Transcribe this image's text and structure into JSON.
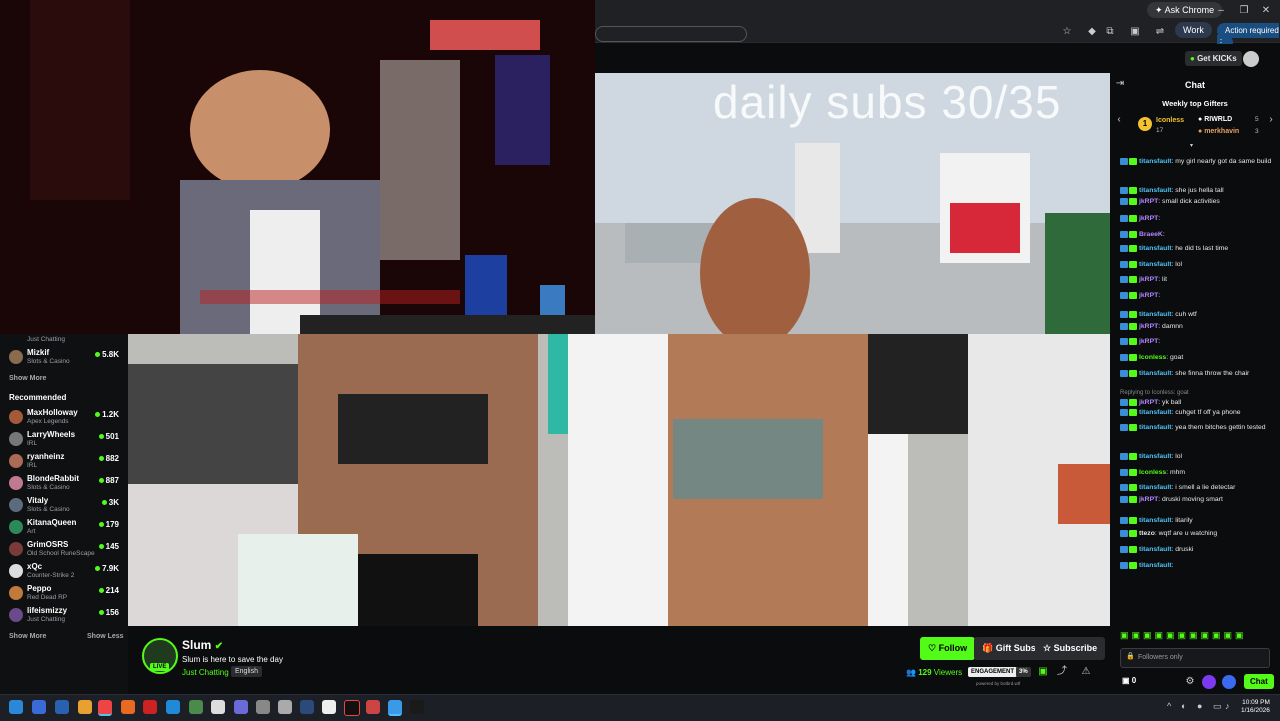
{
  "browser": {
    "ask_label": "Ask Chrome",
    "work_label": "Work",
    "action_label": "Action required"
  },
  "header": {
    "get_kicks": "Get KICKs"
  },
  "overlay_text": "daily subs 30/35",
  "sidebar": {
    "top_items": [
      {
        "name": "",
        "category": "Just Chatting",
        "count": "",
        "color": "#c98a5a"
      },
      {
        "name": "Mizkif",
        "category": "Slots & Casino",
        "count": "5.8K",
        "color": "#8b6b4e"
      }
    ],
    "show_more_1": "Show More",
    "recommended_title": "Recommended",
    "recommended": [
      {
        "name": "MaxHolloway",
        "category": "Apex Legends",
        "count": "1.2K",
        "color": "#a35a3a"
      },
      {
        "name": "LarryWheels",
        "category": "IRL",
        "count": "501",
        "color": "#777"
      },
      {
        "name": "ryanheinz",
        "category": "IRL",
        "count": "882",
        "color": "#aa6a55"
      },
      {
        "name": "BlondeRabbit",
        "category": "Slots & Casino",
        "count": "887",
        "color": "#c07a90"
      },
      {
        "name": "Vitaly",
        "category": "Slots & Casino",
        "count": "3K",
        "color": "#5c6c7c"
      },
      {
        "name": "KitanaQueen",
        "category": "Art",
        "count": "179",
        "color": "#2c8a5a"
      },
      {
        "name": "GrimOSRS",
        "category": "Old School RuneScape",
        "count": "145",
        "color": "#7a3a3a"
      },
      {
        "name": "xQc",
        "category": "Counter-Strike 2",
        "count": "7.9K",
        "color": "#ddd"
      },
      {
        "name": "Peppo",
        "category": "Red Dead RP",
        "count": "214",
        "color": "#c07a3a"
      },
      {
        "name": "lifeismizzy",
        "category": "Just Chatting",
        "count": "156",
        "color": "#6a4a8a"
      }
    ],
    "show_more_2": "Show More",
    "show_less": "Show Less"
  },
  "stream": {
    "channel": "Slum",
    "title": "Slum is here to save the day",
    "category": "Just Chatting",
    "language": "English",
    "live_badge": "LIVE",
    "viewers": "129",
    "viewers_label": "Viewers",
    "engagement_label": "ENGAGEMENT",
    "engagement_value": "3%",
    "powered_by": "powered by botbrd.wtf",
    "follow": "Follow",
    "gift_subs": "Gift Subs",
    "subscribe": "Subscribe"
  },
  "chat": {
    "title": "Chat",
    "gifters_title": "Weekly top Gifters",
    "gifters": [
      {
        "name": "Iconless",
        "count": "17"
      },
      {
        "name": "RIWRLD",
        "count": "5"
      },
      {
        "name": "merkhavin",
        "count": "3"
      }
    ],
    "messages": [
      {
        "user": "titansfault",
        "color": "#4fc3f7",
        "text": "my girl nearly got da same build"
      },
      {
        "user": "titansfault",
        "color": "#4fc3f7",
        "text": "she jus hella tall"
      },
      {
        "user": "jkRPT",
        "color": "#b388ff",
        "text": "small dick activities"
      },
      {
        "user": "jkRPT",
        "color": "#b388ff",
        "text": ""
      },
      {
        "user": "BraeeK",
        "color": "#b388ff",
        "text": ""
      },
      {
        "user": "titansfault",
        "color": "#4fc3f7",
        "text": "he did ts last time"
      },
      {
        "user": "titansfault",
        "color": "#4fc3f7",
        "text": "lol"
      },
      {
        "user": "jkRPT",
        "color": "#b388ff",
        "text": "lit"
      },
      {
        "user": "jkRPT",
        "color": "#b388ff",
        "text": ""
      },
      {
        "user": "titansfault",
        "color": "#4fc3f7",
        "text": "cuh wtf"
      },
      {
        "user": "jkRPT",
        "color": "#b388ff",
        "text": "damnn"
      },
      {
        "user": "jkRPT",
        "color": "#b388ff",
        "text": ""
      },
      {
        "user": "Iconless",
        "color": "#53fc18",
        "text": "goat"
      },
      {
        "user": "titansfault",
        "color": "#4fc3f7",
        "text": "she finna throw the chair"
      },
      {
        "user": "jkRPT",
        "color": "#b388ff",
        "text": "yk ball",
        "reply": "Replying to Iconless: goat"
      },
      {
        "user": "titansfault",
        "color": "#4fc3f7",
        "text": "cuhget tf off ya phone"
      },
      {
        "user": "titansfault",
        "color": "#4fc3f7",
        "text": "yea them bitches gettin tested"
      },
      {
        "user": "titansfault",
        "color": "#4fc3f7",
        "text": "lol"
      },
      {
        "user": "Iconless",
        "color": "#53fc18",
        "text": "mhm"
      },
      {
        "user": "titansfault",
        "color": "#4fc3f7",
        "text": "i smell a lie detectar"
      },
      {
        "user": "jkRPT",
        "color": "#b388ff",
        "text": "druski moving smart"
      },
      {
        "user": "titansfault",
        "color": "#4fc3f7",
        "text": "litarily"
      },
      {
        "user": "ttezo",
        "color": "#e8e8e8",
        "text": "wqtf are u watching"
      },
      {
        "user": "titansfault",
        "color": "#4fc3f7",
        "text": "druski"
      },
      {
        "user": "titansfault",
        "color": "#4fc3f7",
        "text": ""
      }
    ],
    "input_placeholder": "Followers only",
    "kicks_count": "0",
    "send_label": "Chat"
  },
  "taskbar": {
    "time": "10:09 PM",
    "date": "1/16/2026"
  }
}
